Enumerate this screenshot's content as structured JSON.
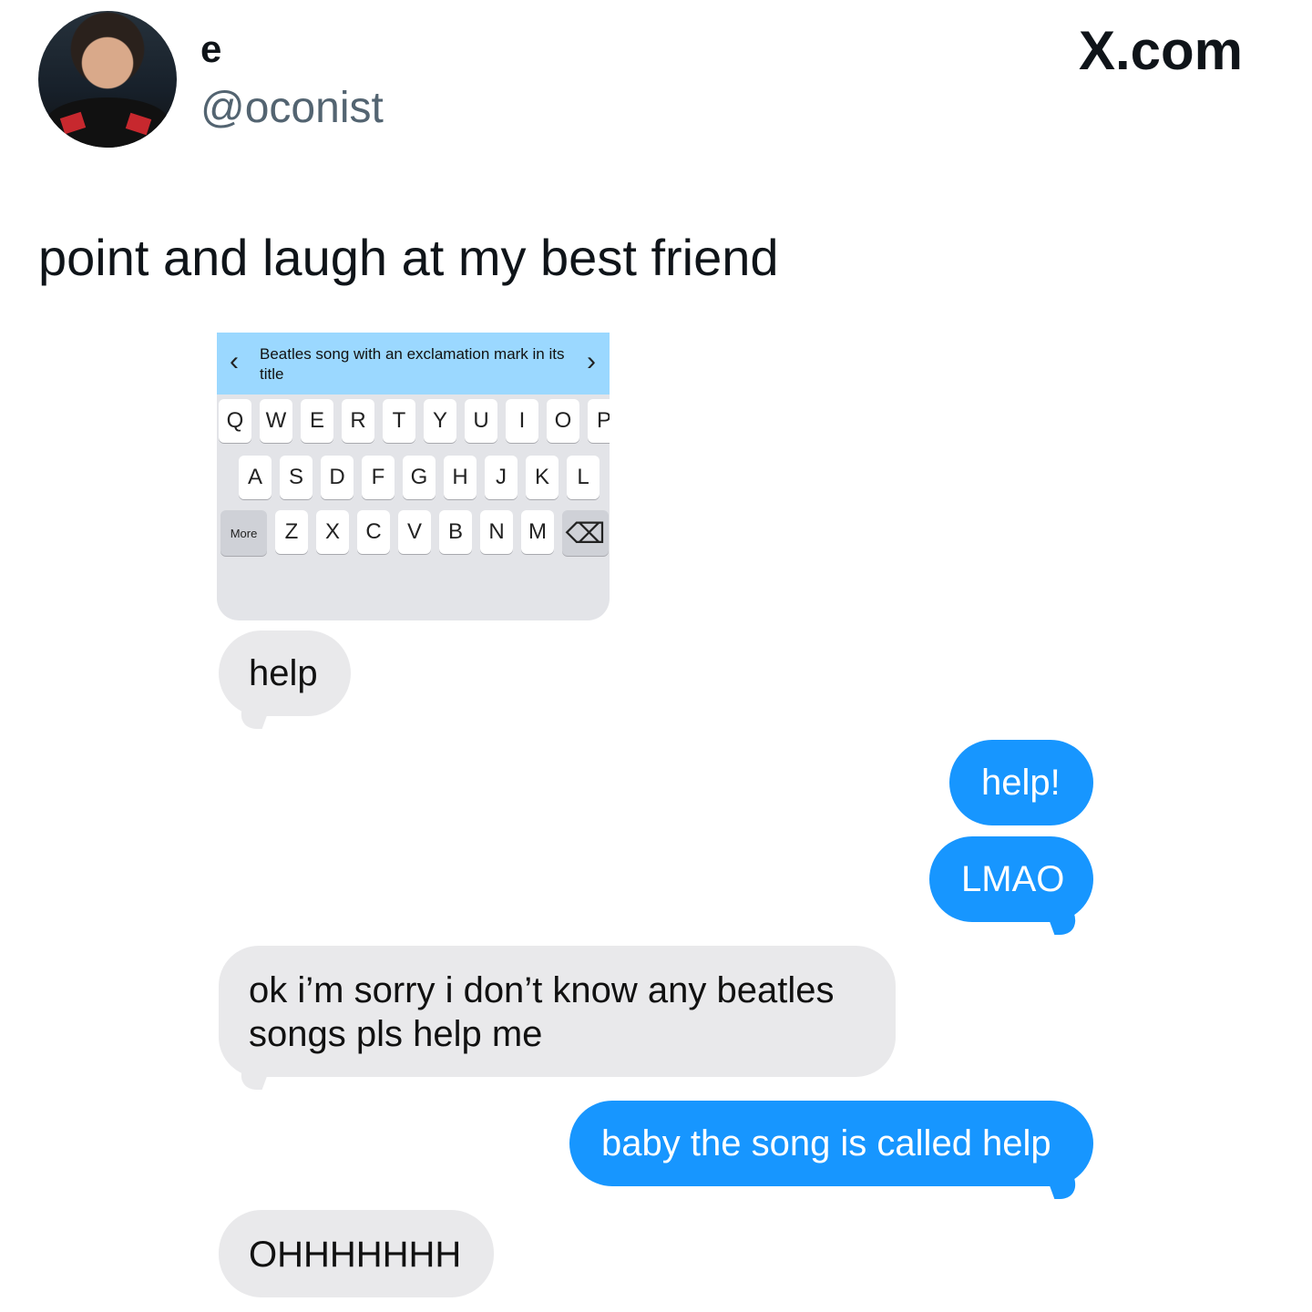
{
  "profile": {
    "display_name": "e",
    "handle": "@oconist",
    "avatar_icon": "profile-photo"
  },
  "brand": "X.com",
  "tweet": {
    "text": "point and laugh at my best friend"
  },
  "keyboard": {
    "suggestion": "Beatles song with an exclamation mark in its title",
    "left_arrow": "‹",
    "right_arrow": "›",
    "rows": [
      [
        "Q",
        "W",
        "E",
        "R",
        "T",
        "Y",
        "U",
        "I",
        "O",
        "P"
      ],
      [
        "A",
        "S",
        "D",
        "F",
        "G",
        "H",
        "J",
        "K",
        "L"
      ],
      [
        "Z",
        "X",
        "C",
        "V",
        "B",
        "N",
        "M"
      ]
    ],
    "more": "More",
    "delete_icon": "⌫"
  },
  "messages": [
    {
      "text": "help",
      "type": "received"
    },
    {
      "text": "help!",
      "type": "sent"
    },
    {
      "text": "LMAO",
      "type": "sent"
    },
    {
      "text": "ok i’m sorry i don’t know any beatles songs pls help me",
      "type": "received"
    },
    {
      "text": "baby the song is called help",
      "type": "sent"
    },
    {
      "text": "OHHHHHHH",
      "type": "received"
    }
  ],
  "colors": {
    "background": "#ffffff",
    "sent_bubble": "#1796ff",
    "received_bubble": "#e9e9eb",
    "suggestion_bar": "#9bd8ff"
  }
}
